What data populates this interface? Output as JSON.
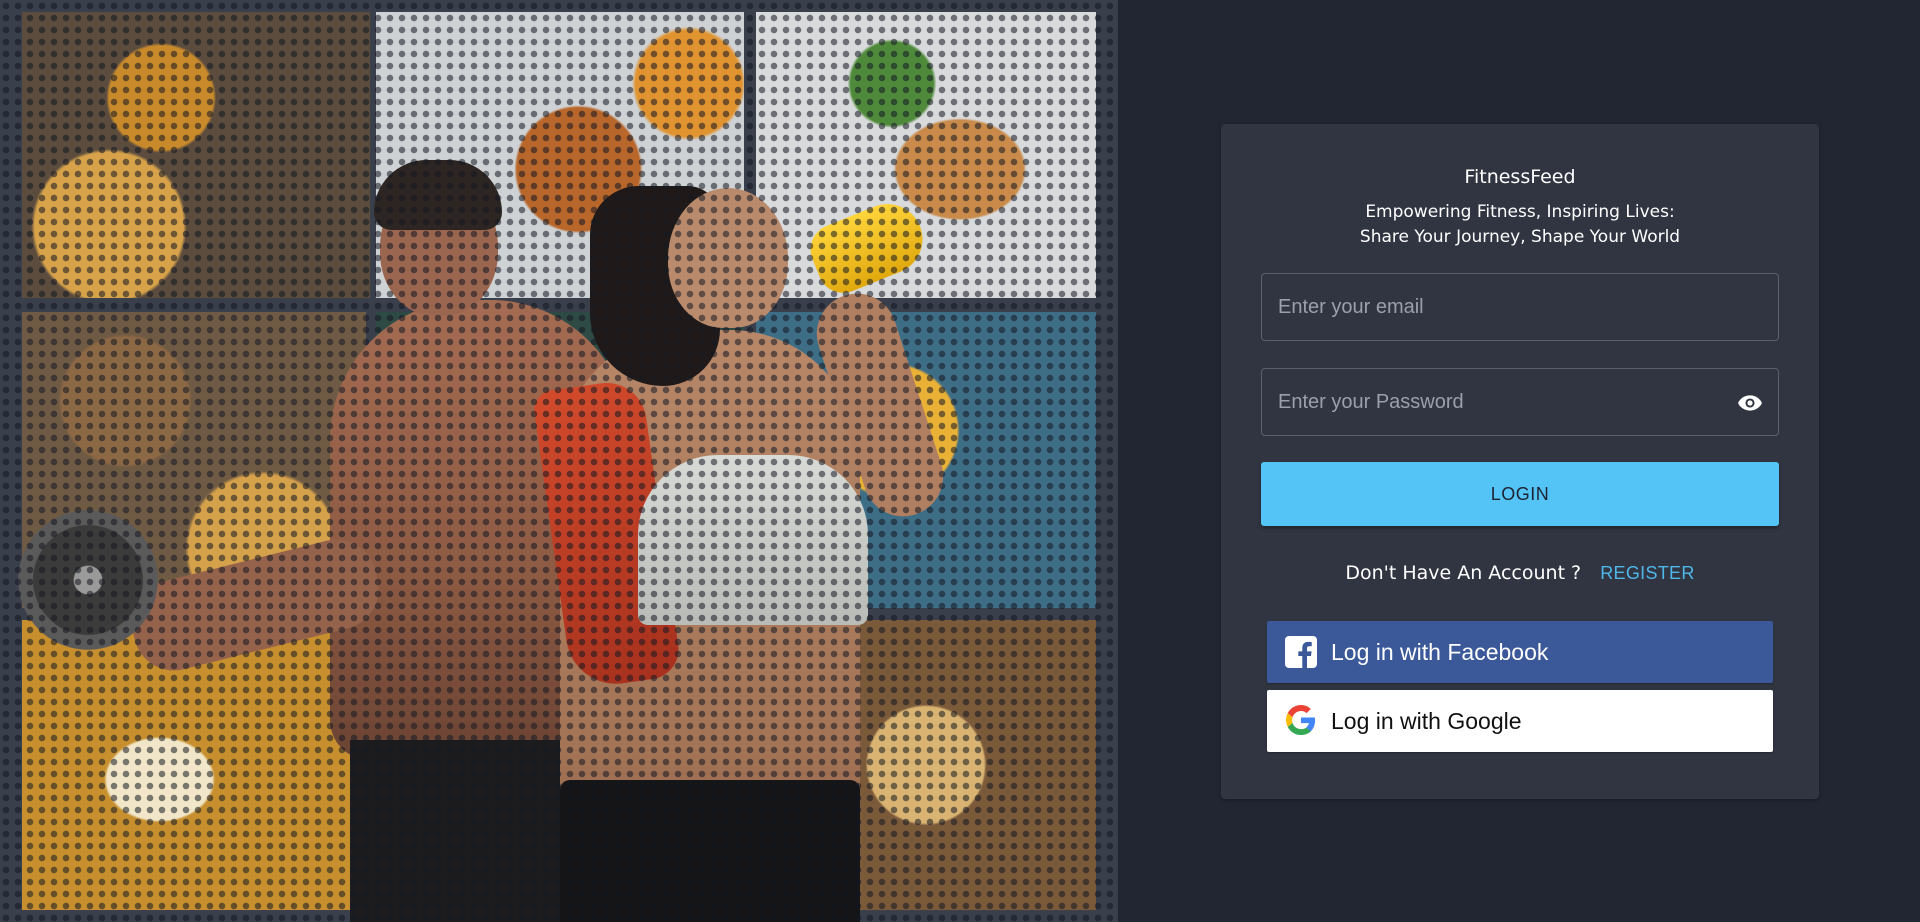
{
  "brand": {
    "name": "FitnessFeed",
    "tagline_line1": "Empowering Fitness, Inspiring Lives:",
    "tagline_line2": "Share Your Journey, Shape Your World"
  },
  "form": {
    "email_placeholder": "Enter your email",
    "email_value": "",
    "password_placeholder": "Enter your Password",
    "password_value": "",
    "login_label": "LOGIN"
  },
  "register": {
    "prompt": "Don't Have An Account ?",
    "link_label": "REGISTER"
  },
  "social": {
    "facebook_label": "Log in with Facebook",
    "google_label": "Log in with Google"
  },
  "icons": {
    "password_toggle": "eye-icon",
    "facebook": "facebook-icon",
    "google": "google-icon"
  },
  "colors": {
    "page_background": "#222633",
    "card_background": "#313541",
    "login_button": "#54c4f7",
    "register_link": "#4fb6ea",
    "facebook_button": "#3b5998",
    "google_button": "#ffffff"
  }
}
